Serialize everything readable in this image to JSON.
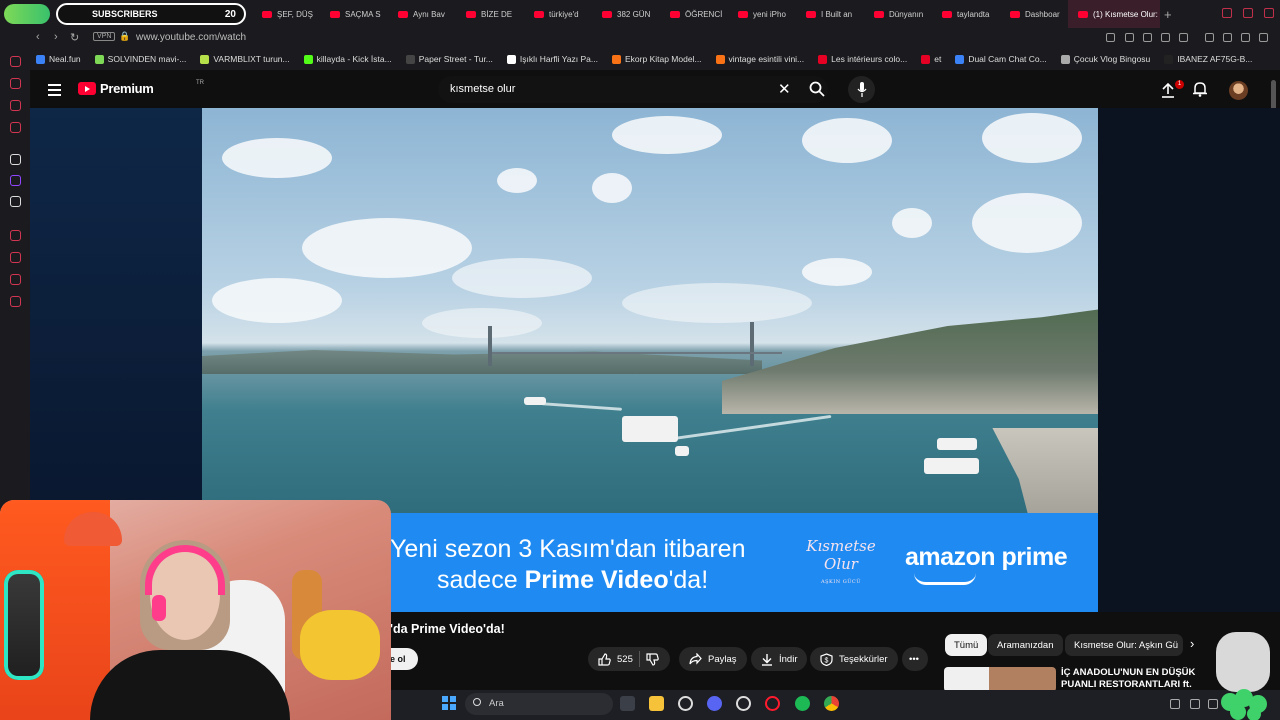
{
  "browser": {
    "widget": {
      "label": "SUBSCRIBERS",
      "count": "20"
    },
    "tabs": [
      {
        "label": "ŞEF, DÜŞ"
      },
      {
        "label": "SAÇMA S"
      },
      {
        "label": "Aynı Bav"
      },
      {
        "label": "BİZE DE"
      },
      {
        "label": "türkiye'd"
      },
      {
        "label": "382 GÜN"
      },
      {
        "label": "ÖĞRENCİ"
      },
      {
        "label": "yeni iPho"
      },
      {
        "label": "I Built an"
      },
      {
        "label": "Dünyanın"
      },
      {
        "label": "taylandta"
      },
      {
        "label": "Dashboar"
      },
      {
        "label": "(1) Kısmetse Olur:"
      }
    ],
    "url": "www.youtube.com/watch",
    "vpn": "VPN",
    "bookmarks": [
      {
        "label": "Neal.fun",
        "color": "#3b82f6"
      },
      {
        "label": "SOLVINDEN mavi-...",
        "color": "#7ed957"
      },
      {
        "label": "VARMBLIXT turun...",
        "color": "#b6e04a"
      },
      {
        "label": "killayda - Kick İsta...",
        "color": "#53fc18"
      },
      {
        "label": "Paper Street - Tur...",
        "color": "#444444"
      },
      {
        "label": "Işıklı Harfli Yazı Pa...",
        "color": "#ffffff"
      },
      {
        "label": "Ekorp Kitap Model...",
        "color": "#f97316"
      },
      {
        "label": "vintage esintili vini...",
        "color": "#f97316"
      },
      {
        "label": "Les intérieurs colo...",
        "color": "#e60023"
      },
      {
        "label": "et",
        "color": "#e60023"
      },
      {
        "label": "Dual Cam Chat Co...",
        "color": "#3b82f6"
      },
      {
        "label": "Çocuk Vlog Bingosu",
        "color": "#aaaaaa"
      },
      {
        "label": "IBANEZ AF75G-B...",
        "color": "#222222"
      }
    ]
  },
  "youtube": {
    "logo": "Premium",
    "region": "TR",
    "search_value": "kısmetse olur",
    "notif_count": "1",
    "banner": {
      "line1": "Yeni sezon 3 Kasım'dan itibaren",
      "line2_pre": "sadece ",
      "line2_bold": "Prime Video",
      "line2_post": "'da!",
      "show_logo_line1": "Kısmetse",
      "show_logo_line2": "Olur",
      "show_logo_sub": "AŞKIN GÜCÜ",
      "brand": "amazon prime"
    },
    "video_title": "'da Prime Video'da!",
    "subscribe_fragment": "e ol",
    "actions": {
      "likes": "525",
      "share": "Paylaş",
      "download": "İndir",
      "thanks": "Teşekkürler"
    },
    "chips": [
      "Tümü",
      "Aramanızdan",
      "Kısmetse Olur: Aşkın Gü"
    ],
    "rec": {
      "title_line1": "İÇ ANADOLU'NUN EN DÜŞÜK",
      "title_line2": "PUANLI RESTORANTLARI ft."
    },
    "accent": "#ff0033"
  },
  "taskbar": {
    "search_placeholder": "Ara"
  }
}
